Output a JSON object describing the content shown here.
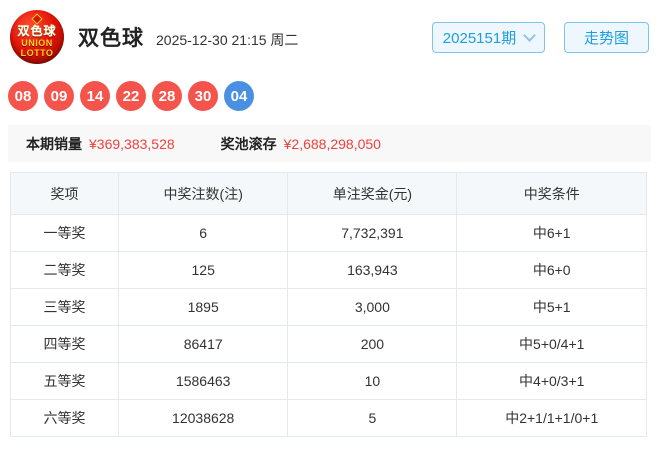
{
  "header": {
    "logo": {
      "line1": "双色球",
      "line2": "UNION",
      "line3": "LOTTO"
    },
    "title": "双色球",
    "datetime": "2025-12-30 21:15 周二",
    "issue_select": {
      "label": "2025151期",
      "icon": "chevron-down"
    },
    "trend_button": "走势图"
  },
  "draw": {
    "red_balls": [
      "08",
      "09",
      "14",
      "22",
      "28",
      "30"
    ],
    "blue_ball": "04"
  },
  "sales": {
    "sales_label": "本期销量",
    "sales_value": "¥369,383,528",
    "pool_label": "奖池滚存",
    "pool_value": "¥2,688,298,050"
  },
  "table": {
    "headers": [
      "奖项",
      "中奖注数(注)",
      "单注奖金(元)",
      "中奖条件"
    ],
    "rows": [
      [
        "一等奖",
        "6",
        "7,732,391",
        "中6+1"
      ],
      [
        "二等奖",
        "125",
        "163,943",
        "中6+0"
      ],
      [
        "三等奖",
        "1895",
        "3,000",
        "中5+1"
      ],
      [
        "四等奖",
        "86417",
        "200",
        "中5+0/4+1"
      ],
      [
        "五等奖",
        "1586463",
        "10",
        "中4+0/3+1"
      ],
      [
        "六等奖",
        "12038628",
        "5",
        "中2+1/1+1/0+1"
      ]
    ]
  },
  "colors": {
    "red_ball": "#f4544c",
    "blue_ball": "#4a90e2",
    "value_red": "#f0413c",
    "button_blue": "#1e9ddf",
    "button_border": "#7fc4ef",
    "button_bg": "#edf7fd",
    "table_header_bg": "#f5f8fa",
    "table_border": "#e4e9ee"
  }
}
